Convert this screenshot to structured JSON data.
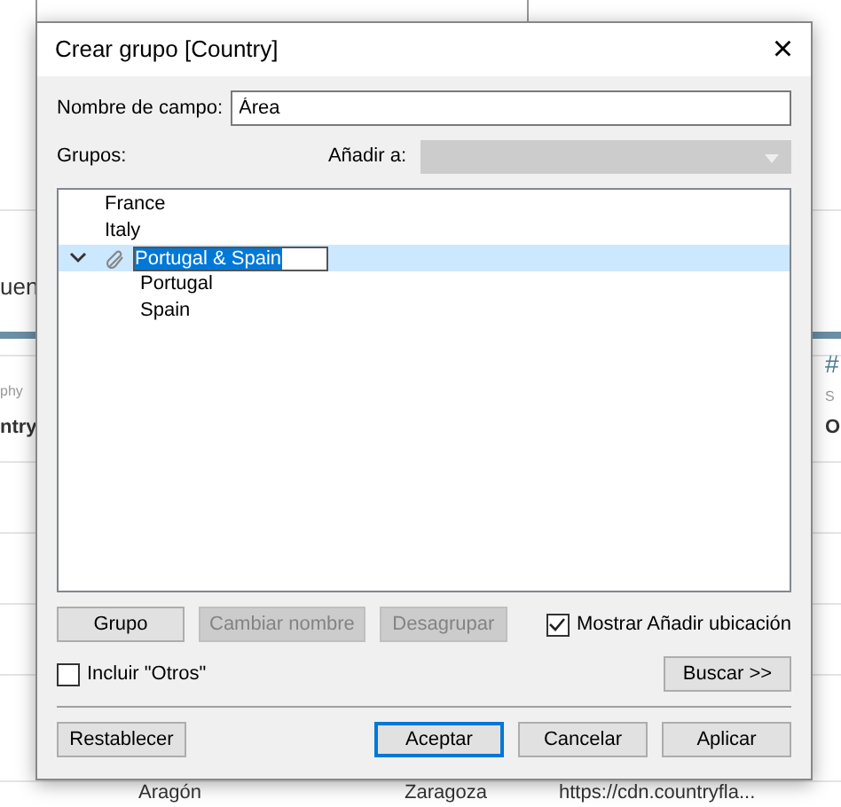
{
  "background": {
    "texts": [
      {
        "text": "uen",
        "kind": "left"
      },
      {
        "text": "phy",
        "kind": "small-left"
      },
      {
        "text": "ntry",
        "kind": "bold-left"
      },
      {
        "text": "#",
        "kind": "right"
      },
      {
        "text": "S",
        "kind": "small-right"
      },
      {
        "text": "O",
        "kind": "bold-right"
      }
    ],
    "row": [
      "Aragón",
      "Zaragoza",
      "https://cdn.countryfla..."
    ]
  },
  "dialog": {
    "title": "Crear grupo [Country]",
    "close": "×",
    "field_label": "Nombre de campo:",
    "field_value": "Área",
    "groups_label": "Grupos:",
    "add_to_label": "Añadir a:",
    "add_to_disabled": true,
    "tree": [
      {
        "label": "France",
        "selected": false
      },
      {
        "label": "Italy",
        "selected": false
      },
      {
        "label": "Portugal & Spain",
        "kind": "group",
        "expanded": true,
        "selected": true,
        "editing": true,
        "children": [
          {
            "label": "Portugal",
            "selected": false
          },
          {
            "label": "Spain",
            "selected": false
          }
        ]
      }
    ],
    "actions": [
      {
        "label": "Grupo",
        "disabled": false
      },
      {
        "label": "Cambiar nombre",
        "disabled": true
      },
      {
        "label": "Desagrupar",
        "disabled": true
      }
    ],
    "show_add_location": {
      "label": "Mostrar Añadir ubicación",
      "checked": true
    },
    "include_others": {
      "label": "Incluir \"Otros\"",
      "checked": false
    },
    "search_button": "Buscar >>",
    "footer": [
      {
        "label": "Restablecer",
        "default": false
      },
      {
        "label": "Aceptar",
        "default": true
      },
      {
        "label": "Cancelar",
        "default": false
      },
      {
        "label": "Aplicar",
        "default": false
      }
    ]
  }
}
